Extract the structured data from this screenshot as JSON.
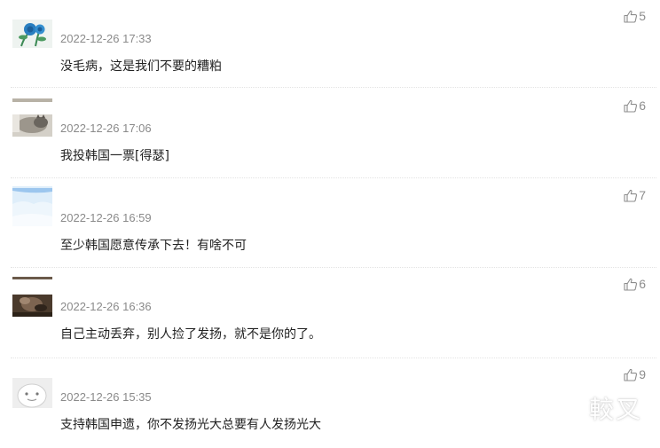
{
  "comments": [
    {
      "username": "",
      "timestamp": "2022-12-26 17:33",
      "text": "没毛病，这是我们不要的糟粕",
      "likes": "5",
      "avatar_icon": "blue-rose-avatar"
    },
    {
      "username": "",
      "timestamp": "2022-12-26 17:06",
      "text": "我投韩国一票[得瑟]",
      "likes": "6",
      "avatar_icon": "cat-photo-avatar"
    },
    {
      "username": "",
      "timestamp": "2022-12-26 16:59",
      "text": "至少韩国愿意传承下去！有啥不可",
      "likes": "7",
      "avatar_icon": "sky-photo-avatar"
    },
    {
      "username": "",
      "timestamp": "2022-12-26 16:36",
      "text": "自己主动丢弃，别人捡了发扬，就不是你的了。",
      "likes": "6",
      "avatar_icon": "brown-photo-avatar"
    },
    {
      "username": "",
      "timestamp": "2022-12-26 15:35",
      "text": "支持韩国申遗，你不发扬光大总要有人发扬光大",
      "likes": "9",
      "avatar_icon": "cartoon-face-avatar"
    }
  ],
  "watermark": "較叉",
  "colors": {
    "timestamp": "#8a8a8a",
    "text": "#222222",
    "like": "#8d8d8d",
    "divider": "#e3e3e3"
  }
}
